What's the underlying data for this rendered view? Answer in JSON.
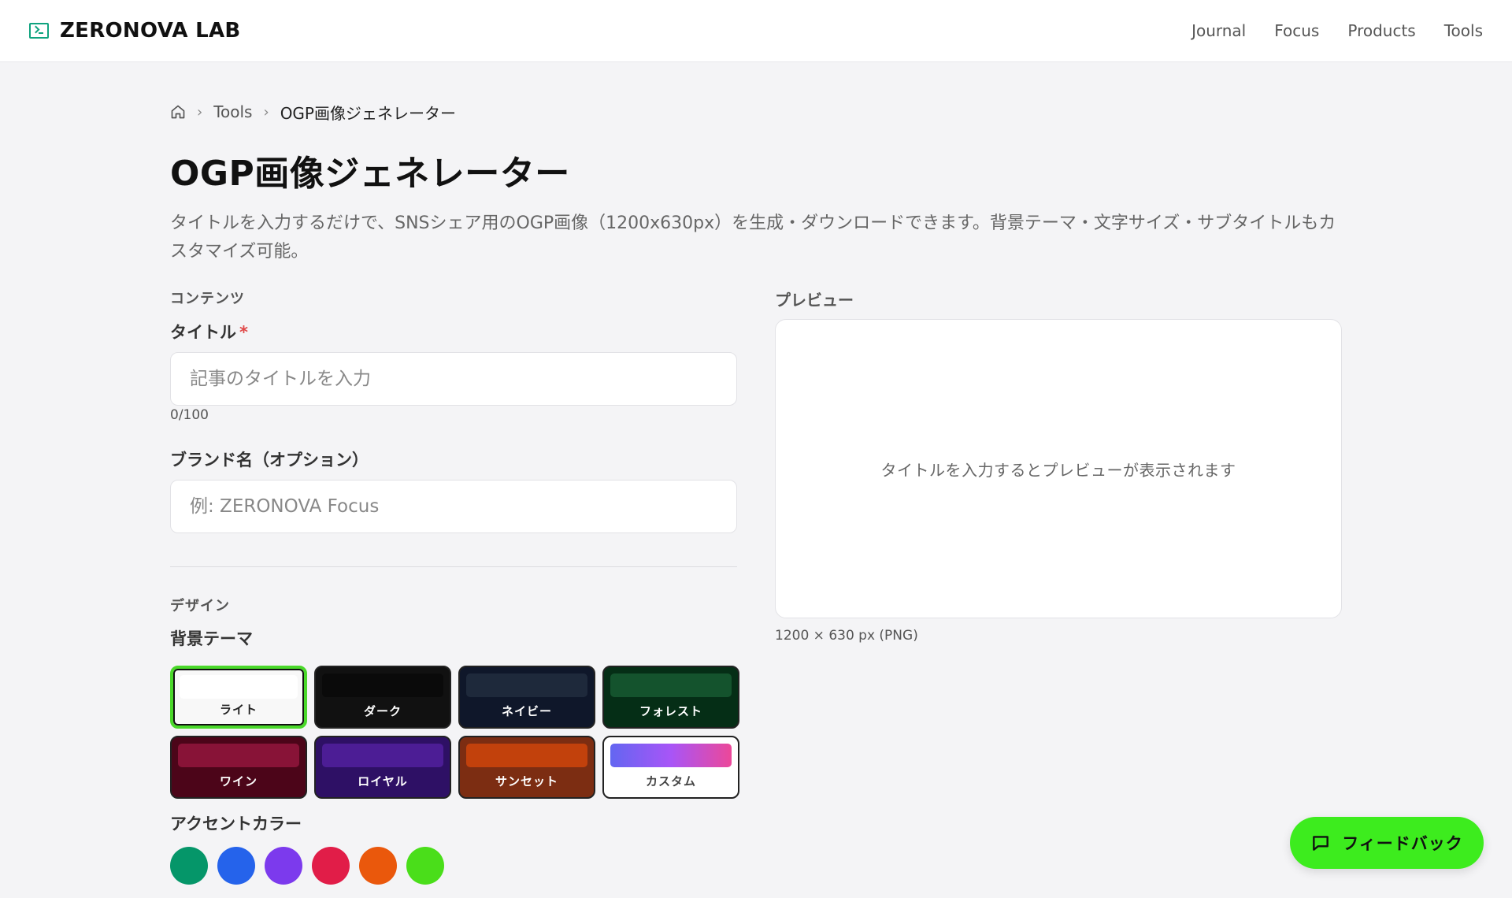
{
  "header": {
    "brand": "ZERONOVA LAB",
    "nav": [
      "Journal",
      "Focus",
      "Products",
      "Tools"
    ]
  },
  "breadcrumb": {
    "items": [
      "Tools",
      "OGP画像ジェネレーター"
    ]
  },
  "page": {
    "title": "OGP画像ジェネレーター",
    "description": "タイトルを入力するだけで、SNSシェア用のOGP画像（1200x630px）を生成・ダウンロードできます。背景テーマ・文字サイズ・サブタイトルもカスタマイズ可能。"
  },
  "content_section": {
    "label": "コンテンツ",
    "title_label": "タイトル",
    "required_mark": "*",
    "title_placeholder": "記事のタイトルを入力",
    "title_count": "0/100",
    "brand_label": "ブランド名（オプション）",
    "brand_placeholder": "例: ZERONOVA Focus"
  },
  "design_section": {
    "label": "デザイン",
    "theme_label": "背景テーマ",
    "themes": [
      {
        "name": "ライト",
        "bg": "#f8f8f8",
        "swatch": "#ffffff",
        "text": "#222222",
        "selected": true
      },
      {
        "name": "ダーク",
        "bg": "#111111",
        "swatch": "#0a0a0a",
        "text": "#ffffff",
        "selected": false
      },
      {
        "name": "ネイビー",
        "bg": "#0f172a",
        "swatch": "#1e293b",
        "text": "#ffffff",
        "selected": false
      },
      {
        "name": "フォレスト",
        "bg": "#052e16",
        "swatch": "#14532d",
        "text": "#ffffff",
        "selected": false
      },
      {
        "name": "ワイン",
        "bg": "#4c0519",
        "swatch": "#881337",
        "text": "#ffffff",
        "selected": false
      },
      {
        "name": "ロイヤル",
        "bg": "#2e1065",
        "swatch": "#4c1d95",
        "text": "#ffffff",
        "selected": false
      },
      {
        "name": "サンセット",
        "bg": "#7c2d12",
        "swatch": "#c2410c",
        "text": "#ffffff",
        "selected": false
      },
      {
        "name": "カスタム",
        "bg": "#ffffff",
        "swatch": "linear-gradient(90deg,#6366f1,#a855f7,#ec4899)",
        "text": "#444444",
        "selected": false
      }
    ],
    "accent_label": "アクセントカラー",
    "accents": [
      "#059669",
      "#2563eb",
      "#7c3aed",
      "#e11d48",
      "#ea580c",
      "#4ade1a"
    ]
  },
  "preview": {
    "label": "プレビュー",
    "empty_message": "タイトルを入力するとプレビューが表示されます",
    "meta": "1200 × 630 px (PNG)"
  },
  "feedback": {
    "label": "フィードバック"
  }
}
